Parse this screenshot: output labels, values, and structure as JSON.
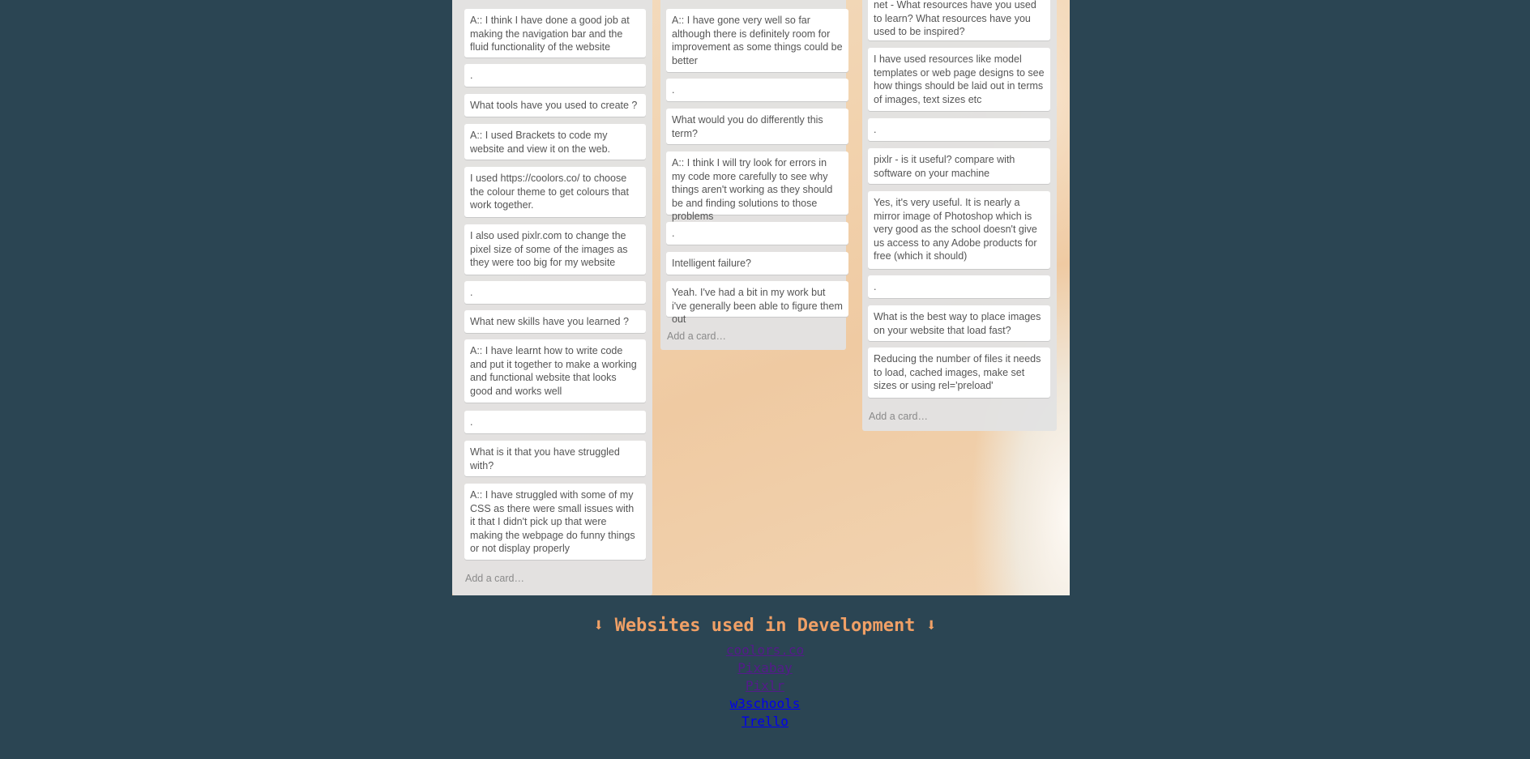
{
  "board": {
    "list1": {
      "cards": [
        "A:: I think I have done a good job at making the navigation bar and the fluid functionality of the website",
        ".",
        "What tools have you used to create ?",
        "A:: I used Brackets to code my website and view it on the web.",
        "I used https://coolors.co/ to choose the colour theme to get colours that work together.",
        "I also used pixlr.com to change the pixel size of some of the images as they were too big for my website",
        ".",
        "What new skills have you learned ?",
        "A:: I have learnt how to write code and put it together to make a working and functional website that looks good and works well",
        ".",
        "What is it that you have struggled with?",
        "A:: I have struggled with some of my CSS as there were small issues with it that I didn't pick up that were making the webpage do funny things or not display properly"
      ],
      "add_card": "Add a card…"
    },
    "list2": {
      "cards": [
        "A:: I have gone very well so far although there is definitely room for improvement as some things could be better",
        ".",
        "What would you do differently this term?",
        "A:: I think I will try look for errors in my code more carefully to see why things aren't working as they should be and finding solutions to those problems",
        ".",
        "Intelligent failure?",
        "Yeah. I've had a bit in my work but i've generally been able to figure them out"
      ],
      "add_card": "Add a card…"
    },
    "list3": {
      "cards": [
        "net - What resources have you used to learn? What resources have you used to be inspired?",
        "I have used resources like model templates or web page designs to see how things should be laid out in terms of images, text sizes etc",
        ".",
        "pixlr - is it useful? compare with software on your machine",
        "Yes, it's very useful. It is nearly a mirror image of Photoshop which is very good as the school doesn't give us access to any Adobe products for free (which it should)",
        ".",
        "What is the best way to place images on your website that load fast?",
        "Reducing the number of files it needs to load, cached images, make set sizes or using rel='preload'"
      ],
      "add_card": "Add a card…"
    }
  },
  "footer": {
    "title": "⬇ Websites used in Development ⬇",
    "links": [
      "coolors.co",
      "Pixabay",
      "Pixlr",
      "w3schools",
      "Trello"
    ]
  },
  "colors": {
    "page_background": "#2b4553",
    "title": "#f0a066",
    "link_visited": "#551a8b",
    "link_unvisited": "#0000ee"
  }
}
